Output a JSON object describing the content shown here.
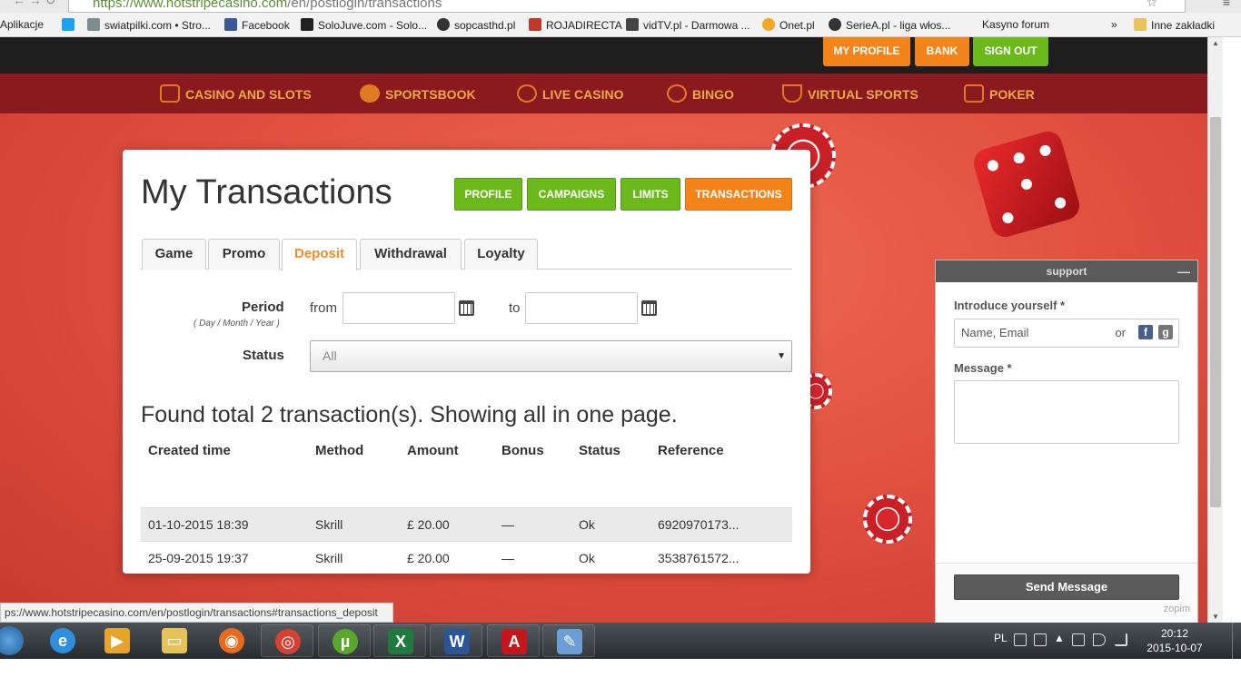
{
  "browser": {
    "url_host": "https://www.hotstripecasino.com",
    "url_path": "/en/postlogin/transactions",
    "bookmarks": [
      {
        "label": "Aplikacje",
        "color": "#2a7ad8"
      },
      {
        "label": "swiatpilki.com • Stro...",
        "color": "#7f8c8d"
      },
      {
        "label": "Facebook",
        "color": "#3b5998"
      },
      {
        "label": "SoloJuve.com - Solo...",
        "color": "#222222"
      },
      {
        "label": "sopcasthd.pl",
        "color": "#333333"
      },
      {
        "label": "ROJADIRECTA",
        "color": "#c0392b"
      },
      {
        "label": "vidTV.pl - Darmowa ...",
        "color": "#444444"
      },
      {
        "label": "Onet.pl",
        "color": "#f5a623"
      },
      {
        "label": "SerieA.pl - liga włos...",
        "color": "#333333"
      },
      {
        "label": "Kasyno forum",
        "color": "#f2f2f2"
      },
      {
        "label": "»",
        "color": "#f2f2f2"
      },
      {
        "label": "Inne zakładki",
        "color": "#e8c25a"
      }
    ]
  },
  "site": {
    "top_buttons": [
      {
        "label": "MY PROFILE",
        "color": "#f4841a"
      },
      {
        "label": "BANK",
        "color": "#f4841a"
      },
      {
        "label": "SIGN OUT",
        "color": "#6cb91c"
      }
    ],
    "nav": [
      {
        "label": "CASINO AND SLOTS",
        "icon": "slot-machine-icon"
      },
      {
        "label": "SPORTSBOOK",
        "icon": "basketball-icon"
      },
      {
        "label": "LIVE CASINO",
        "icon": "roulette-icon"
      },
      {
        "label": "BINGO",
        "icon": "bingo-ball-icon"
      },
      {
        "label": "VIRTUAL SPORTS",
        "icon": "trophy-icon"
      },
      {
        "label": "POKER",
        "icon": "playing-card-icon"
      }
    ]
  },
  "panel": {
    "title": "My Transactions",
    "buttons": [
      {
        "label": "PROFILE",
        "active": false
      },
      {
        "label": "CAMPAIGNS",
        "active": false
      },
      {
        "label": "LIMITS",
        "active": false
      },
      {
        "label": "TRANSACTIONS",
        "active": true
      }
    ],
    "tabs": [
      {
        "label": "Game",
        "active": false
      },
      {
        "label": "Promo",
        "active": false
      },
      {
        "label": "Deposit",
        "active": true
      },
      {
        "label": "Withdrawal",
        "active": false
      },
      {
        "label": "Loyalty",
        "active": false
      }
    ],
    "filter": {
      "period_label": "Period",
      "period_hint": "( Day / Month / Year )",
      "from_label": "from",
      "from_value": "",
      "to_label": "to",
      "to_value": "",
      "status_label": "Status",
      "status_value": "All"
    },
    "found_text": "Found total 2 transaction(s). Showing all in one page.",
    "table": {
      "headers": [
        "Created time",
        "Method",
        "Amount",
        "Bonus",
        "Status",
        "Reference"
      ],
      "rows": [
        [
          "01-10-2015 18:39",
          "Skrill",
          "£ 20.00",
          "—",
          "Ok",
          "6920970173..."
        ],
        [
          "25-09-2015 19:37",
          "Skrill",
          "£ 20.00",
          "—",
          "Ok",
          "3538761572..."
        ]
      ]
    }
  },
  "support": {
    "title": "support",
    "minimize": "—",
    "introduce_label": "Introduce yourself *",
    "name_placeholder": "Name, Email",
    "or_text": "or",
    "message_label": "Message *",
    "send_label": "Send Message",
    "brand": "zopim"
  },
  "status_url": "ps://www.hotstripecasino.com/en/postlogin/transactions#transactions_deposit",
  "taskbar": {
    "apps": [
      {
        "name": "internet-explorer",
        "glyph": "e",
        "color": "#2f8fdc"
      },
      {
        "name": "media-player",
        "glyph": "▶",
        "color": "#e8a32c"
      },
      {
        "name": "file-explorer",
        "glyph": "▭",
        "color": "#e6c25a"
      },
      {
        "name": "firefox",
        "glyph": "◉",
        "color": "#e66a1f"
      },
      {
        "name": "chrome",
        "glyph": "◎",
        "color": "#d44236"
      },
      {
        "name": "utorrent",
        "glyph": "µ",
        "color": "#59a72c"
      },
      {
        "name": "excel",
        "glyph": "X",
        "color": "#1f7a3d"
      },
      {
        "name": "word",
        "glyph": "W",
        "color": "#2a5699"
      },
      {
        "name": "acrobat",
        "glyph": "A",
        "color": "#c4161c"
      },
      {
        "name": "notepad",
        "glyph": "✎",
        "color": "#6b9dd6"
      }
    ],
    "lang": "PL",
    "time": "20:12",
    "date": "2015-10-07"
  }
}
